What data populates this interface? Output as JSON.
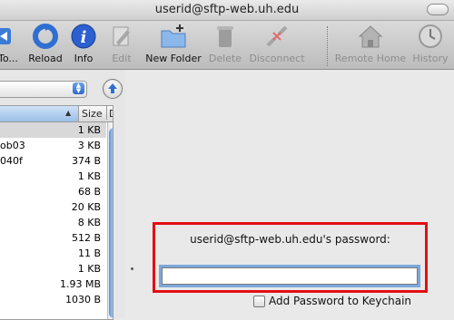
{
  "window": {
    "title": "userid@sftp-web.uh.edu"
  },
  "toolbar": {
    "buttons": [
      {
        "label": "To...",
        "icon": "connect-icon"
      },
      {
        "label": "Reload",
        "icon": "reload-icon"
      },
      {
        "label": "Info",
        "icon": "info-icon"
      },
      {
        "label": "Edit",
        "icon": "edit-icon"
      },
      {
        "label": "New Folder",
        "icon": "new-folder-icon"
      },
      {
        "label": "Delete",
        "icon": "trash-icon"
      },
      {
        "label": "Disconnect",
        "icon": "disconnect-icon"
      },
      {
        "label": "Remote Home",
        "icon": "remote-home-icon"
      },
      {
        "label": "History",
        "icon": "history-icon"
      }
    ]
  },
  "browser": {
    "columns": {
      "size": "Size",
      "d": "D"
    },
    "rows": [
      {
        "name": "",
        "size": "1 KB"
      },
      {
        "name": "ob03",
        "size": "3 KB"
      },
      {
        "name": "040f",
        "size": "374 B"
      },
      {
        "name": "",
        "size": "1 KB"
      },
      {
        "name": "",
        "size": "68 B"
      },
      {
        "name": "",
        "size": "20 KB"
      },
      {
        "name": "",
        "size": "8 KB"
      },
      {
        "name": "",
        "size": "512 B"
      },
      {
        "name": "",
        "size": "11 B"
      },
      {
        "name": "",
        "size": "1 KB"
      },
      {
        "name": "",
        "size": "1.93 MB"
      },
      {
        "name": "",
        "size": "1030 B"
      }
    ]
  },
  "password_sheet": {
    "label": "userid@sftp-web.uh.edu's password:",
    "value": "",
    "keychain_label": "Add Password to Keychain",
    "keychain_checked": false
  },
  "colors": {
    "highlight_border": "#e30e13",
    "focus_ring": "#7ea7dc",
    "selection": "#d8d8d8"
  }
}
